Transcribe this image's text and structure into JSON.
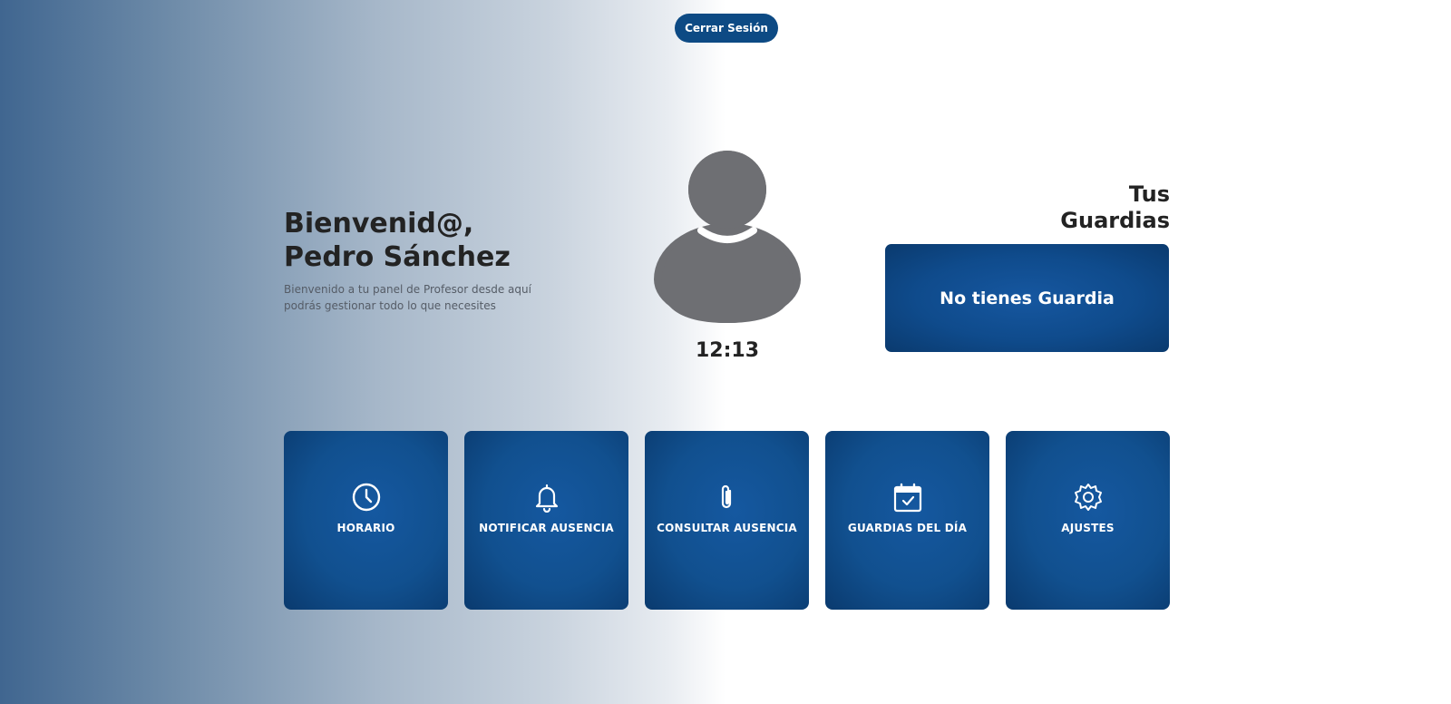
{
  "header": {
    "logout_label": "Cerrar Sesión"
  },
  "welcome": {
    "greeting": "Bienvenid@,",
    "name": "Pedro Sánchez",
    "description": "Bienvenido a tu panel de Profesor desde aquí podrás gestionar todo lo que necesites"
  },
  "profile": {
    "avatar_icon": "user-silhouette-icon",
    "time": "12:13"
  },
  "guards": {
    "title_line1": "Tus",
    "title_line2": "Guardias",
    "status": "No tienes Guardia"
  },
  "tiles": [
    {
      "label": "HORARIO",
      "icon": "clock-icon"
    },
    {
      "label": "NOTIFICAR AUSENCIA",
      "icon": "bell-icon"
    },
    {
      "label": "CONSULTAR AUSENCIA",
      "icon": "paperclip-icon"
    },
    {
      "label": "GUARDIAS DEL DÍA",
      "icon": "calendar-check-icon"
    },
    {
      "label": "AJUSTES",
      "icon": "gear-icon"
    }
  ],
  "colors": {
    "primary": "#0d4a84",
    "text": "#232323",
    "avatar": "#6e6f73"
  }
}
